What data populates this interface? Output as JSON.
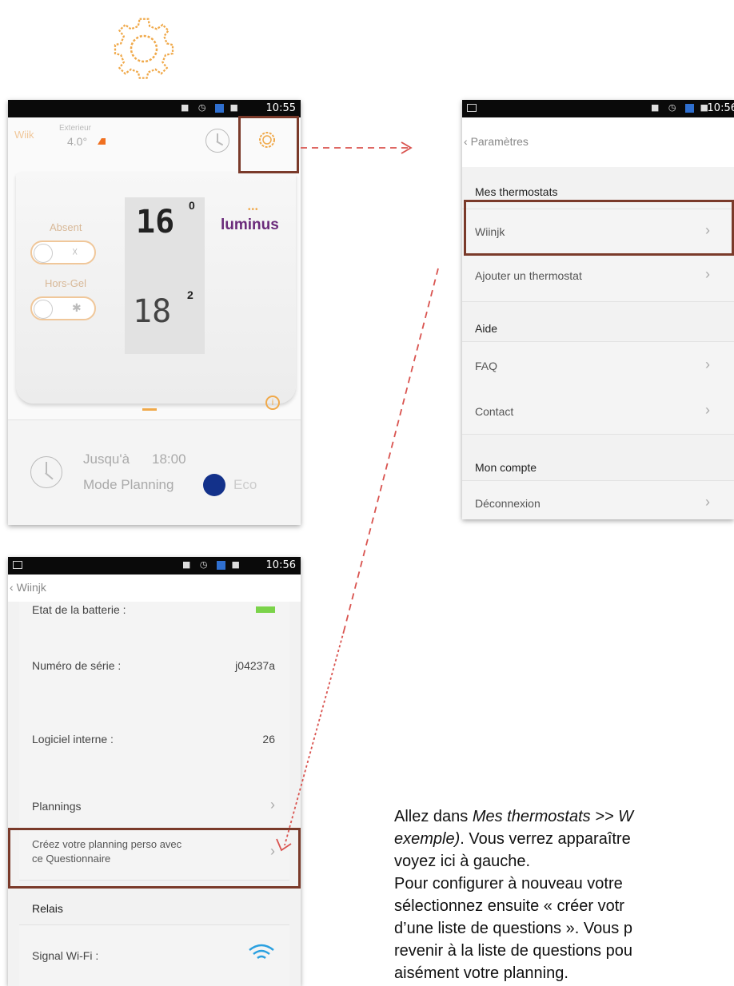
{
  "phone_home": {
    "time": "10:55",
    "brand": "Wiik",
    "exterior_label": "Exterieur",
    "exterior_temp": "4.0°",
    "absent_label": "Absent",
    "hors_gel_label": "Hors-Gel",
    "display_top": "16",
    "display_top_sup": "0",
    "display_bottom": "18",
    "display_bottom_sup": "2",
    "logo_text": "luminus",
    "until_text": "Jusqu'à",
    "until_time": "18:00",
    "mode_text": "Mode Planning",
    "eco_text": "Eco"
  },
  "phone_settings": {
    "time": "10:56",
    "back_label": "Paramètres",
    "section_thermostats": "Mes thermostats",
    "item_wiinjk": "Wiinjk",
    "item_add": "Ajouter un thermostat",
    "section_help": "Aide",
    "item_faq": "FAQ",
    "item_contact": "Contact",
    "section_account": "Mon compte",
    "item_logout": "Déconnexion"
  },
  "phone_detail": {
    "time": "10:56",
    "back_label": "Wiinjk",
    "battery_label": "Etat de la batterie :",
    "serial_label": "Numéro de série :",
    "serial_value": "j04237a",
    "firmware_label": "Logiciel interne :",
    "firmware_value": "26",
    "plannings_label": "Plannings",
    "create_planning_line1": "Créez votre planning perso avec",
    "create_planning_line2": "ce Questionnaire",
    "section_relay": "Relais",
    "wifi_label": "Signal Wi-Fi :"
  },
  "instructions": {
    "line1_prefix": "Allez dans ",
    "line1_italic": "Mes thermostats >> W",
    "line2_italic": "exemple)",
    "line2_rest": ". Vous verrez apparaître",
    "line3": "voyez ici à gauche.",
    "line4": "Pour configurer à nouveau votre",
    "line5": "sélectionnez ensuite « créer votr",
    "line6": "d’une liste de questions ». Vous p",
    "line7": "revenir à la liste de questions pou",
    "line8": "aisément votre planning."
  },
  "colors": {
    "accent_orange": "#f0a94a",
    "box_brown": "#7a3a2a",
    "arrow_red": "#d9534f",
    "eco_blue": "#13318a"
  }
}
